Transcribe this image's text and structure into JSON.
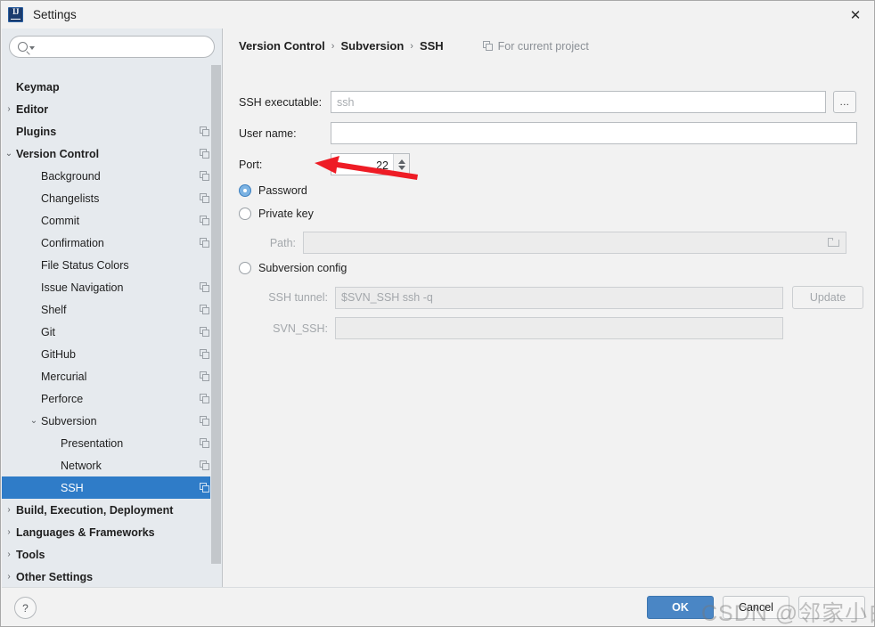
{
  "window": {
    "title": "Settings",
    "app_icon": "intellij-idea-icon",
    "close_icon": "close-icon"
  },
  "sidebar": {
    "search": {
      "placeholder": "",
      "value": "",
      "icon": "search-icon",
      "caret_icon": "chevron-down-icon"
    },
    "items": [
      {
        "label": "Keymap",
        "indent": 1,
        "bold": true,
        "arrow": "",
        "copy": false,
        "selected": false
      },
      {
        "label": "Editor",
        "indent": 1,
        "bold": true,
        "arrow": "›",
        "copy": false,
        "selected": false
      },
      {
        "label": "Plugins",
        "indent": 1,
        "bold": true,
        "arrow": "",
        "copy": true,
        "selected": false
      },
      {
        "label": "Version Control",
        "indent": 1,
        "bold": true,
        "arrow": "⌄",
        "copy": true,
        "selected": false
      },
      {
        "label": "Background",
        "indent": 2,
        "bold": false,
        "arrow": "",
        "copy": true,
        "selected": false
      },
      {
        "label": "Changelists",
        "indent": 2,
        "bold": false,
        "arrow": "",
        "copy": true,
        "selected": false
      },
      {
        "label": "Commit",
        "indent": 2,
        "bold": false,
        "arrow": "",
        "copy": true,
        "selected": false
      },
      {
        "label": "Confirmation",
        "indent": 2,
        "bold": false,
        "arrow": "",
        "copy": true,
        "selected": false
      },
      {
        "label": "File Status Colors",
        "indent": 2,
        "bold": false,
        "arrow": "",
        "copy": false,
        "selected": false
      },
      {
        "label": "Issue Navigation",
        "indent": 2,
        "bold": false,
        "arrow": "",
        "copy": true,
        "selected": false
      },
      {
        "label": "Shelf",
        "indent": 2,
        "bold": false,
        "arrow": "",
        "copy": true,
        "selected": false
      },
      {
        "label": "Git",
        "indent": 2,
        "bold": false,
        "arrow": "",
        "copy": true,
        "selected": false
      },
      {
        "label": "GitHub",
        "indent": 2,
        "bold": false,
        "arrow": "",
        "copy": true,
        "selected": false
      },
      {
        "label": "Mercurial",
        "indent": 2,
        "bold": false,
        "arrow": "",
        "copy": true,
        "selected": false
      },
      {
        "label": "Perforce",
        "indent": 2,
        "bold": false,
        "arrow": "",
        "copy": true,
        "selected": false
      },
      {
        "label": "Subversion",
        "indent": 2,
        "bold": false,
        "arrow": "⌄",
        "copy": true,
        "selected": false
      },
      {
        "label": "Presentation",
        "indent": 3,
        "bold": false,
        "arrow": "",
        "copy": true,
        "selected": false
      },
      {
        "label": "Network",
        "indent": 3,
        "bold": false,
        "arrow": "",
        "copy": true,
        "selected": false
      },
      {
        "label": "SSH",
        "indent": 3,
        "bold": false,
        "arrow": "",
        "copy": true,
        "selected": true
      },
      {
        "label": "Build, Execution, Deployment",
        "indent": 1,
        "bold": true,
        "arrow": "›",
        "copy": false,
        "selected": false
      },
      {
        "label": "Languages & Frameworks",
        "indent": 1,
        "bold": true,
        "arrow": "›",
        "copy": false,
        "selected": false
      },
      {
        "label": "Tools",
        "indent": 1,
        "bold": true,
        "arrow": "›",
        "copy": false,
        "selected": false
      },
      {
        "label": "Other Settings",
        "indent": 1,
        "bold": true,
        "arrow": "›",
        "copy": false,
        "selected": false
      }
    ]
  },
  "main": {
    "breadcrumb": {
      "part1": "Version Control",
      "sep1": "›",
      "part2": "Subversion",
      "sep2": "›",
      "part3": "SSH"
    },
    "project_note": {
      "label": "For current project",
      "icon": "copy-icon"
    },
    "fields": {
      "ssh_executable_label": "SSH executable:",
      "ssh_executable_value": "",
      "ssh_executable_placeholder": "ssh",
      "browse_label": "...",
      "user_name_label": "User name:",
      "user_name_value": "",
      "port_label": "Port:",
      "port_value": "22",
      "path_label": "Path:",
      "path_value": "",
      "ssh_tunnel_label": "SSH tunnel:",
      "ssh_tunnel_value": "$SVN_SSH ssh -q",
      "svn_ssh_label": "SVN_SSH:",
      "svn_ssh_value": "",
      "update_label": "Update"
    },
    "auth_options": [
      {
        "label": "Password",
        "checked": true
      },
      {
        "label": "Private key",
        "checked": false
      },
      {
        "label": "Subversion config",
        "checked": false
      }
    ]
  },
  "footer": {
    "help_label": "?",
    "ok_label": "OK",
    "cancel_label": "Cancel",
    "apply_label": ""
  },
  "overlay": {
    "watermark": "CSDN @邻家小白",
    "arrow_color": "#ee1c25"
  }
}
